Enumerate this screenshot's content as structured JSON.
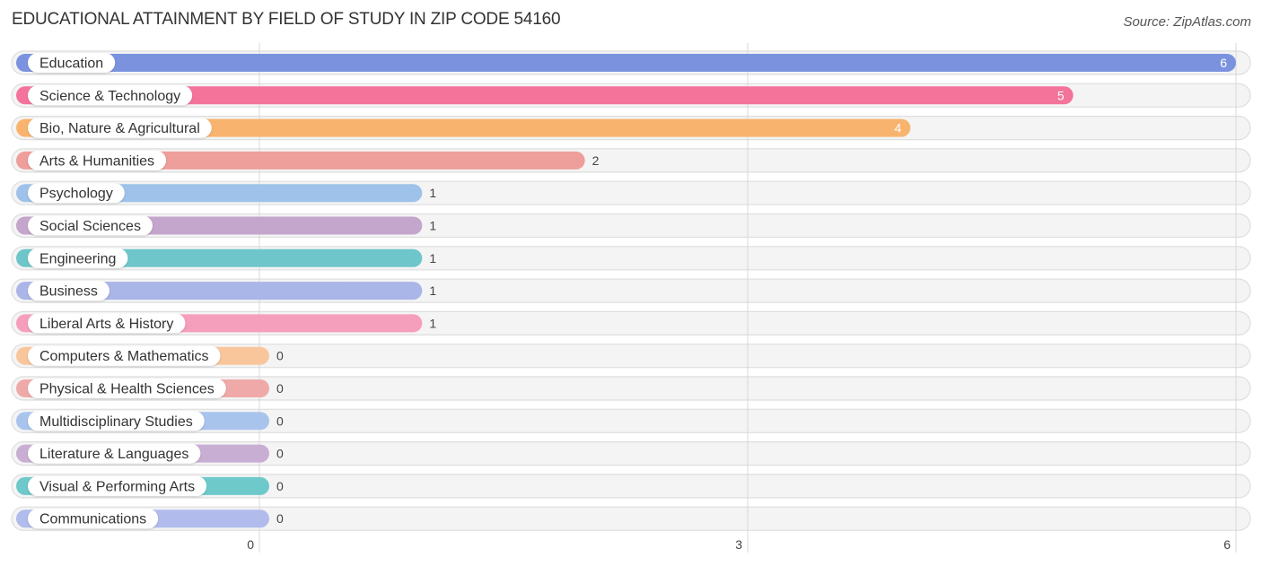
{
  "title": "EDUCATIONAL ATTAINMENT BY FIELD OF STUDY IN ZIP CODE 54160",
  "source": "Source: ZipAtlas.com",
  "chart_data": {
    "type": "bar",
    "orientation": "horizontal",
    "title": "EDUCATIONAL ATTAINMENT BY FIELD OF STUDY IN ZIP CODE 54160",
    "xlabel": "",
    "ylabel": "",
    "xlim": [
      0,
      6
    ],
    "xticks": [
      0,
      3,
      6
    ],
    "grid": true,
    "categories": [
      "Education",
      "Science & Technology",
      "Bio, Nature & Agricultural",
      "Arts & Humanities",
      "Psychology",
      "Social Sciences",
      "Engineering",
      "Business",
      "Liberal Arts & History",
      "Computers & Mathematics",
      "Physical & Health Sciences",
      "Multidisciplinary Studies",
      "Literature & Languages",
      "Visual & Performing Arts",
      "Communications"
    ],
    "values": [
      6,
      5,
      4,
      2,
      1,
      1,
      1,
      1,
      1,
      0,
      0,
      0,
      0,
      0,
      0
    ],
    "colors": [
      "#7b93df",
      "#f3739b",
      "#f8b46e",
      "#ee9e9b",
      "#9ec2e9",
      "#c4a6cc",
      "#6ec6cb",
      "#aab5e8",
      "#f59fbd",
      "#f9c69c",
      "#f0a9a9",
      "#a9c4ec",
      "#c9aed4",
      "#6ec9cb",
      "#b1bbec"
    ]
  }
}
